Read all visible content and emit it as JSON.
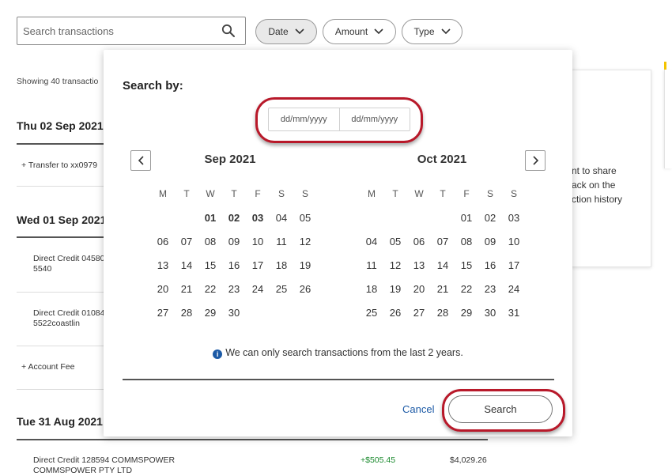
{
  "toolbar": {
    "search_placeholder": "Search transactions",
    "filters": [
      {
        "label": "Date",
        "active": true
      },
      {
        "label": "Amount",
        "active": false
      },
      {
        "label": "Type",
        "active": false
      }
    ]
  },
  "list": {
    "showing": "Showing 40 transactio",
    "groups": [
      {
        "date": "Thu 02 Sep 2021",
        "items": [
          "Transfer to xx0979"
        ],
        "item_prefix": "+"
      },
      {
        "date": "Wed 01 Sep 2021",
        "items": [
          "Direct Credit 04580",
          "5540",
          "Direct Credit 01084",
          "5522coastlin",
          "Account Fee"
        ]
      },
      {
        "date": "Tue 31 Aug 2021"
      }
    ],
    "bottom_row": {
      "desc": "Direct Credit 128594 COMMSPOWER",
      "desc2": "COMMSPOWER PTY LTD",
      "amount": "+$505.45",
      "balance": "$4,029.26"
    }
  },
  "side_card": {
    "lines": [
      "nt to share",
      "ack on the",
      "ction history"
    ]
  },
  "popup": {
    "title": "Search by:",
    "from_placeholder": "dd/mm/yyyy",
    "to_placeholder": "dd/mm/yyyy",
    "weekdays": [
      "M",
      "T",
      "W",
      "T",
      "F",
      "S",
      "S"
    ],
    "months": [
      {
        "title": "Sep 2021",
        "weeks": [
          [
            "",
            "",
            "01",
            "02",
            "03",
            "04",
            "05"
          ],
          [
            "06",
            "07",
            "08",
            "09",
            "10",
            "11",
            "12"
          ],
          [
            "13",
            "14",
            "15",
            "16",
            "17",
            "18",
            "19"
          ],
          [
            "20",
            "21",
            "22",
            "23",
            "24",
            "25",
            "26"
          ],
          [
            "27",
            "28",
            "29",
            "30",
            "",
            "",
            ""
          ]
        ],
        "bold": [
          "01",
          "02",
          "03"
        ]
      },
      {
        "title": "Oct 2021",
        "weeks": [
          [
            "",
            "",
            "",
            "",
            "01",
            "02",
            "03"
          ],
          [
            "04",
            "05",
            "06",
            "07",
            "08",
            "09",
            "10"
          ],
          [
            "11",
            "12",
            "13",
            "14",
            "15",
            "16",
            "17"
          ],
          [
            "18",
            "19",
            "20",
            "21",
            "22",
            "23",
            "24"
          ],
          [
            "25",
            "26",
            "27",
            "28",
            "29",
            "30",
            "31"
          ]
        ],
        "bold": []
      }
    ],
    "info_text": "We can only search transactions from the last 2 years.",
    "cancel_label": "Cancel",
    "search_label": "Search"
  },
  "colors": {
    "accent_blue": "#1c5aa6",
    "highlight_red": "#b8192a",
    "brand_yellow": "#f4c400"
  }
}
